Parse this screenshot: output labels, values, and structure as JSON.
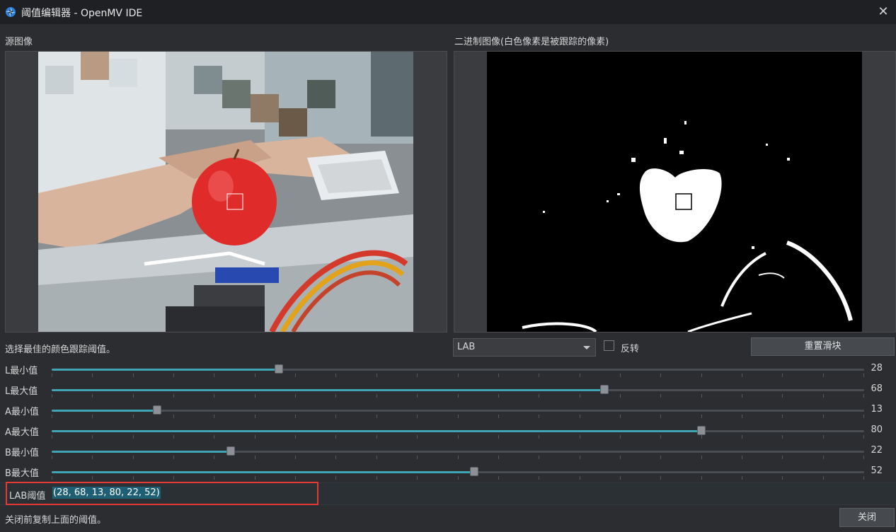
{
  "window": {
    "title": "阈值编辑器 - OpenMV IDE",
    "close_symbol": "✕",
    "logo_icon": "openmv-logo-icon"
  },
  "source_panel": {
    "label": "源图像"
  },
  "binary_panel": {
    "label": "二进制图像(白色像素是被跟踪的像素)"
  },
  "instruction": "选择最佳的颜色跟踪阈值。",
  "color_space": {
    "selected": "LAB"
  },
  "invert": {
    "label": "反转",
    "checked": false
  },
  "reset_button": {
    "label": "重置滑块"
  },
  "sliders": [
    {
      "name": "L最小值",
      "value": 28
    },
    {
      "name": "L最大值",
      "value": 68
    },
    {
      "name": "A最小值",
      "value": 13
    },
    {
      "name": "A最大值",
      "value": 80
    },
    {
      "name": "B最小值",
      "value": 22
    },
    {
      "name": "B最大值",
      "value": 52
    }
  ],
  "result": {
    "label": "LAB阈值",
    "value": "(28, 68, 13, 80, 22, 52)"
  },
  "footer": {
    "hint": "关闭前复制上面的阈值。",
    "close_label": "关闭"
  },
  "colors": {
    "accent": "#3fa4b4",
    "highlight": "#e53935",
    "selection": "#1f5f76"
  }
}
